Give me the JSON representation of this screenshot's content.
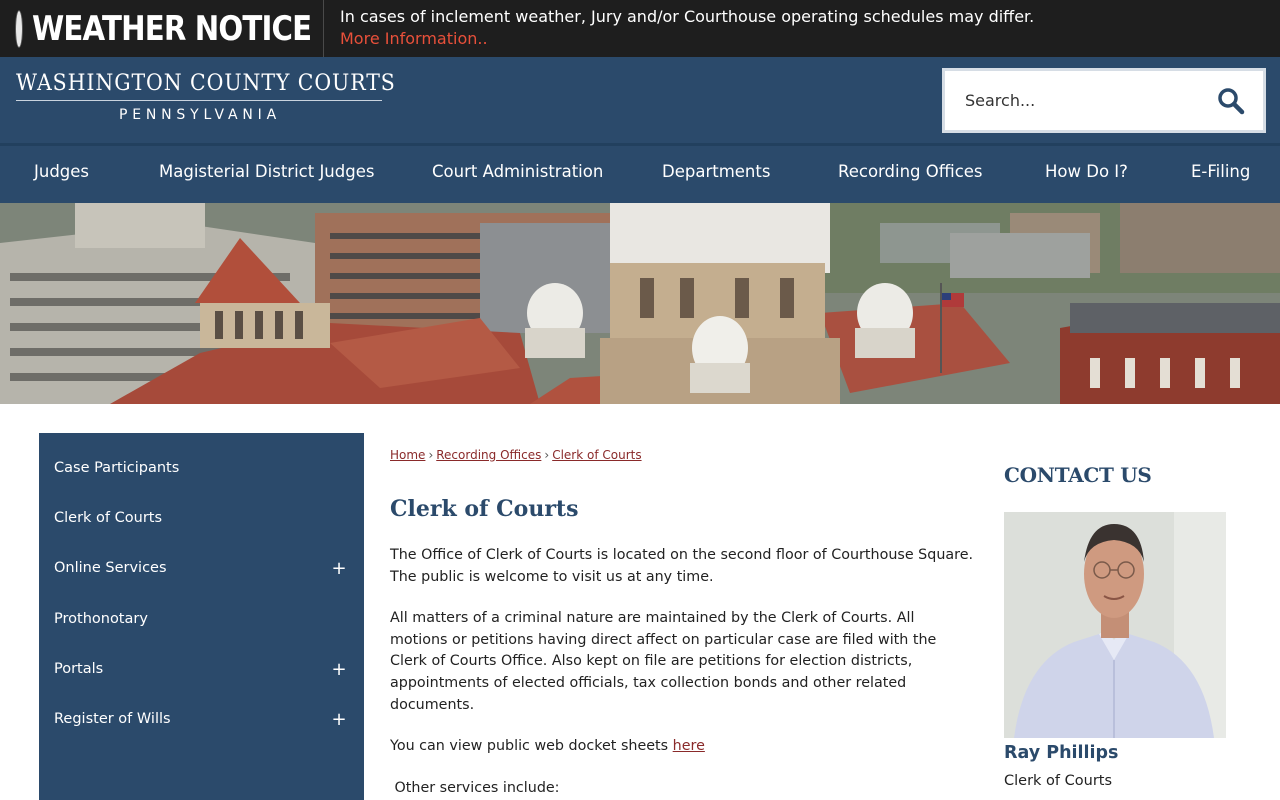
{
  "alert": {
    "title": "WEATHER NOTICE",
    "message": "In cases of inclement weather, Jury and/or Courthouse operating schedules may differ.",
    "link": "More Information.."
  },
  "header": {
    "logo_main": "WASHINGTON COUNTY COURTS",
    "logo_sub": "PENNSYLVANIA",
    "search_placeholder": "Search..."
  },
  "nav": {
    "items": [
      "Judges",
      "Magisterial District Judges",
      "Court Administration",
      "Departments",
      "Recording Offices",
      "How Do I?",
      "E-Filing"
    ]
  },
  "sidebar": {
    "items": [
      {
        "label": "Case Participants",
        "expand": ""
      },
      {
        "label": "Clerk of Courts",
        "expand": ""
      },
      {
        "label": "Online Services",
        "expand": "+"
      },
      {
        "label": "Prothonotary",
        "expand": ""
      },
      {
        "label": "Portals",
        "expand": "+"
      },
      {
        "label": "Register of Wills",
        "expand": "+"
      }
    ]
  },
  "breadcrumb": {
    "items": [
      "Home",
      "Recording Offices",
      "Clerk of Courts"
    ],
    "separator": "›"
  },
  "main": {
    "title": "Clerk of Courts",
    "p1": "The Office of Clerk of Courts is located on the second floor of Courthouse Square. The public is welcome to visit us at any time.",
    "p2": "All matters of a criminal nature are maintained by the Clerk of Courts. All motions or petitions having direct affect on particular case are filed with the Clerk of Courts Office. Also kept on file are petitions for election districts, appointments of elected officials, tax collection bonds and other related documents.",
    "p3_text": "You can view public web docket sheets ",
    "p3_link": "here",
    "p4": " Other services include:"
  },
  "contact": {
    "title": "CONTACT US",
    "name": "Ray Phillips",
    "role": "Clerk of Courts"
  },
  "colors": {
    "brand_navy": "#2b4a6b",
    "alert_bg": "#1e1e1e",
    "alert_link": "#e8503a",
    "link": "#8a2a2a"
  }
}
